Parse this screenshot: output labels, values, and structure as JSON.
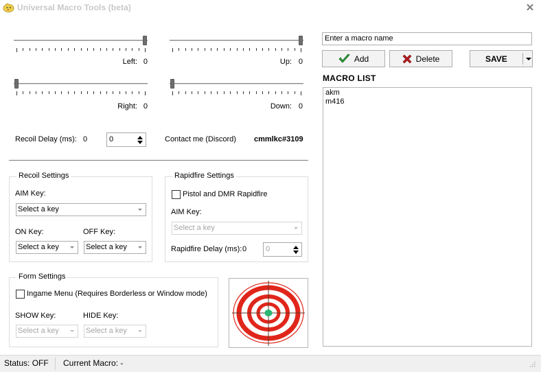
{
  "window": {
    "title": "Universal Macro Tools (beta)",
    "icon": "app-face-icon",
    "close_icon": "close-icon"
  },
  "sliders": {
    "left": {
      "label": "Left:",
      "value": "0",
      "position": 1.0
    },
    "up": {
      "label": "Up:",
      "value": "0",
      "position": 1.0
    },
    "right": {
      "label": "Right:",
      "value": "0",
      "position": 0.0
    },
    "down": {
      "label": "Down:",
      "value": "0",
      "position": 0.0
    }
  },
  "recoil_delay": {
    "label": "Recoil Delay (ms):",
    "value": "0",
    "spinner_value": "0"
  },
  "contact": {
    "label": "Contact me (Discord)",
    "handle": "cmmlkc#3109"
  },
  "recoil_settings": {
    "title": "Recoil Settings",
    "aim_key_label": "AIM Key:",
    "aim_key_value": "Select a key",
    "on_key_label": "ON Key:",
    "on_key_value": "Select a key",
    "off_key_label": "OFF Key:",
    "off_key_value": "Select a key"
  },
  "rapidfire_settings": {
    "title": "Rapidfire Settings",
    "checkbox_label": "Pistol and DMR Rapidfire",
    "checked": false,
    "aim_key_label": "AIM Key:",
    "aim_key_value": "Select a key",
    "delay_label": "Rapidfire Delay (ms):",
    "delay_value": "0",
    "delay_spinner_value": "0"
  },
  "form_settings": {
    "title": "Form Settings",
    "checkbox_label": "Ingame Menu (Requires Borderless or Window mode)",
    "checked": false,
    "show_key_label": "SHOW Key:",
    "show_key_value": "Select a key",
    "hide_key_label": "HIDE Key:",
    "hide_key_value": "Select a key"
  },
  "macro_panel": {
    "name_input_value": "Enter a macro name",
    "add_label": "Add",
    "delete_label": "Delete",
    "save_label": "SAVE",
    "list_title": "MACRO LIST",
    "items": [
      "akm",
      "m416"
    ]
  },
  "target_image": {
    "icon": "target-icon",
    "ring_color": "#e0261b",
    "center_color": "#2bb673"
  },
  "statusbar": {
    "status": "Status: OFF",
    "current_macro": "Current Macro: -"
  }
}
